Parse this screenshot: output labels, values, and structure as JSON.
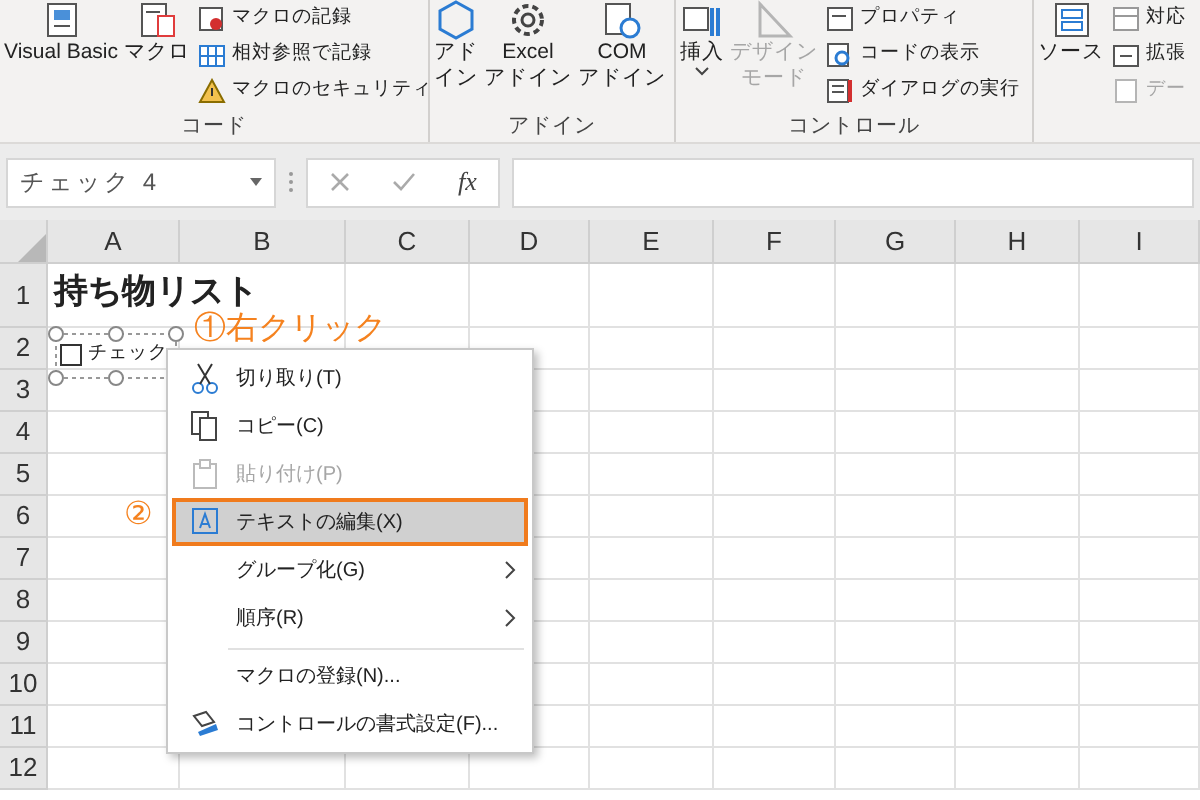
{
  "ribbon": {
    "groups": [
      {
        "label": "コード",
        "large": [
          {
            "lines": [
              "Visual Basic"
            ],
            "dropdown": false,
            "disabled": false
          },
          {
            "lines": [
              "マクロ"
            ],
            "dropdown": false,
            "disabled": false
          }
        ],
        "small": [
          {
            "label": "マクロの記録",
            "disabled": false
          },
          {
            "label": "相対参照で記録",
            "disabled": false
          },
          {
            "label": "マクロのセキュリティ",
            "disabled": false
          }
        ]
      },
      {
        "label": "アドイン",
        "large": [
          {
            "lines": [
              "アド",
              "イン"
            ],
            "dropdown": false,
            "disabled": false
          },
          {
            "lines": [
              "Excel",
              "アドイン"
            ],
            "dropdown": false,
            "disabled": false
          },
          {
            "lines": [
              "COM",
              "アドイン"
            ],
            "dropdown": false,
            "disabled": false
          }
        ]
      },
      {
        "label": "コントロール",
        "large": [
          {
            "lines": [
              "挿入"
            ],
            "dropdown": true,
            "disabled": false
          },
          {
            "lines": [
              "デザイン",
              "モード"
            ],
            "dropdown": false,
            "disabled": true
          }
        ],
        "small": [
          {
            "label": "プロパティ",
            "disabled": false
          },
          {
            "label": "コードの表示",
            "disabled": false
          },
          {
            "label": "ダイアログの実行",
            "disabled": false
          }
        ]
      },
      {
        "large": [
          {
            "lines": [
              "ソース"
            ],
            "dropdown": false,
            "disabled": false
          }
        ],
        "small": [
          {
            "label": "対応",
            "disabled": false
          },
          {
            "label": "拡張",
            "disabled": false
          },
          {
            "label": "デー",
            "disabled": true
          }
        ]
      }
    ]
  },
  "name_box": {
    "value": "チェック 4"
  },
  "formula_bar": {
    "function_label": "fx"
  },
  "sheet": {
    "columns": [
      "A",
      "B",
      "C",
      "D",
      "E",
      "F",
      "G",
      "H",
      "I"
    ],
    "rows": [
      {
        "header": "1",
        "cells": [
          "持ち物リスト"
        ]
      },
      {
        "header": "2",
        "cells": []
      },
      {
        "header": "3",
        "cells": []
      },
      {
        "header": "4",
        "cells": []
      },
      {
        "header": "5",
        "cells": []
      },
      {
        "header": "6",
        "cells": []
      },
      {
        "header": "7",
        "cells": []
      },
      {
        "header": "8",
        "cells": []
      },
      {
        "header": "9",
        "cells": []
      },
      {
        "header": "10",
        "cells": []
      },
      {
        "header": "11",
        "cells": []
      },
      {
        "header": "12",
        "cells": []
      }
    ],
    "checkbox": {
      "label": "チェック",
      "checked": false
    }
  },
  "context_menu": {
    "items": [
      {
        "label": "切り取り(T)",
        "disabled": false,
        "highlighted": false,
        "submenu": false,
        "separator_before": false
      },
      {
        "label": "コピー(C)",
        "disabled": false,
        "highlighted": false,
        "submenu": false,
        "separator_before": false
      },
      {
        "label": "貼り付け(P)",
        "disabled": true,
        "highlighted": false,
        "submenu": false,
        "separator_before": false
      },
      {
        "label": "テキストの編集(X)",
        "disabled": false,
        "highlighted": true,
        "submenu": false,
        "separator_before": false
      },
      {
        "label": "グループ化(G)",
        "disabled": false,
        "highlighted": false,
        "submenu": true,
        "separator_before": false
      },
      {
        "label": "順序(R)",
        "disabled": false,
        "highlighted": false,
        "submenu": true,
        "separator_before": false
      },
      {
        "label": "マクロの登録(N)...",
        "disabled": false,
        "highlighted": false,
        "submenu": false,
        "separator_before": true
      },
      {
        "label": "コントロールの書式設定(F)...",
        "disabled": false,
        "highlighted": false,
        "submenu": false,
        "separator_before": false
      }
    ]
  },
  "annotations": [
    {
      "text": "①右クリック"
    },
    {
      "text": "②"
    }
  ]
}
